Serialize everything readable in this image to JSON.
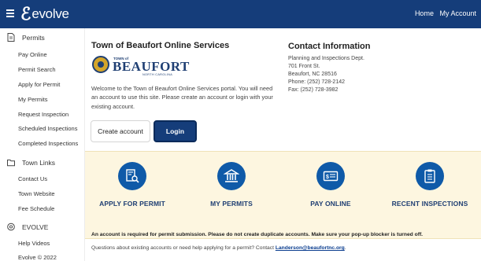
{
  "topbar": {
    "brand": "evolve",
    "nav": [
      "Home",
      "My Account"
    ]
  },
  "sidebar": {
    "sections": [
      {
        "label": "Permits",
        "icon": "document-icon",
        "items": [
          "Pay Online",
          "Permit Search",
          "Apply for Permit",
          "My Permits",
          "Request Inspection",
          "Scheduled Inspections",
          "Completed Inspections"
        ]
      },
      {
        "label": "Town Links",
        "icon": "folder-icon",
        "items": [
          "Contact Us",
          "Town Website",
          "Fee Schedule"
        ]
      },
      {
        "label": "EVOLVE",
        "icon": "evolve-icon",
        "items": [
          "Help Videos",
          "Evolve © 2022"
        ]
      }
    ]
  },
  "intro": {
    "title": "Town of Beaufort Online Services",
    "logo": {
      "town_of": "TOWN of",
      "name": "BEAUFORT",
      "state": "NORTH CAROLINA"
    },
    "welcome": "Welcome to the Town of Beaufort Online Services portal. You will need an account to use this site. Please create an account or login with your existing account.",
    "create_account": "Create account",
    "login": "Login"
  },
  "contact": {
    "title": "Contact Information",
    "lines": [
      "Planning and Inspections Dept.",
      "701 Front St.",
      "Beaufort, NC 28516",
      "Phone: (252) 728-2142",
      "Fax: (252) 728-3982"
    ]
  },
  "tiles": [
    {
      "label": "APPLY FOR PERMIT",
      "icon": "document-search-icon"
    },
    {
      "label": "MY PERMITS",
      "icon": "building-icon"
    },
    {
      "label": "PAY ONLINE",
      "icon": "money-icon"
    },
    {
      "label": "RECENT INSPECTIONS",
      "icon": "clipboard-icon"
    }
  ],
  "notice": "An account is required for permit submission. Please do not create duplicate accounts. Make sure your pop-up blocker is turned off.",
  "question": {
    "text": "Questions about existing accounts or need help applying for a permit? Contact",
    "email": "Landerson@beaufortnc.org",
    "suffix": "."
  },
  "colors": {
    "primary": "#153d7a",
    "tile_blue": "#0f5aa8",
    "band": "#fdf6e0"
  }
}
